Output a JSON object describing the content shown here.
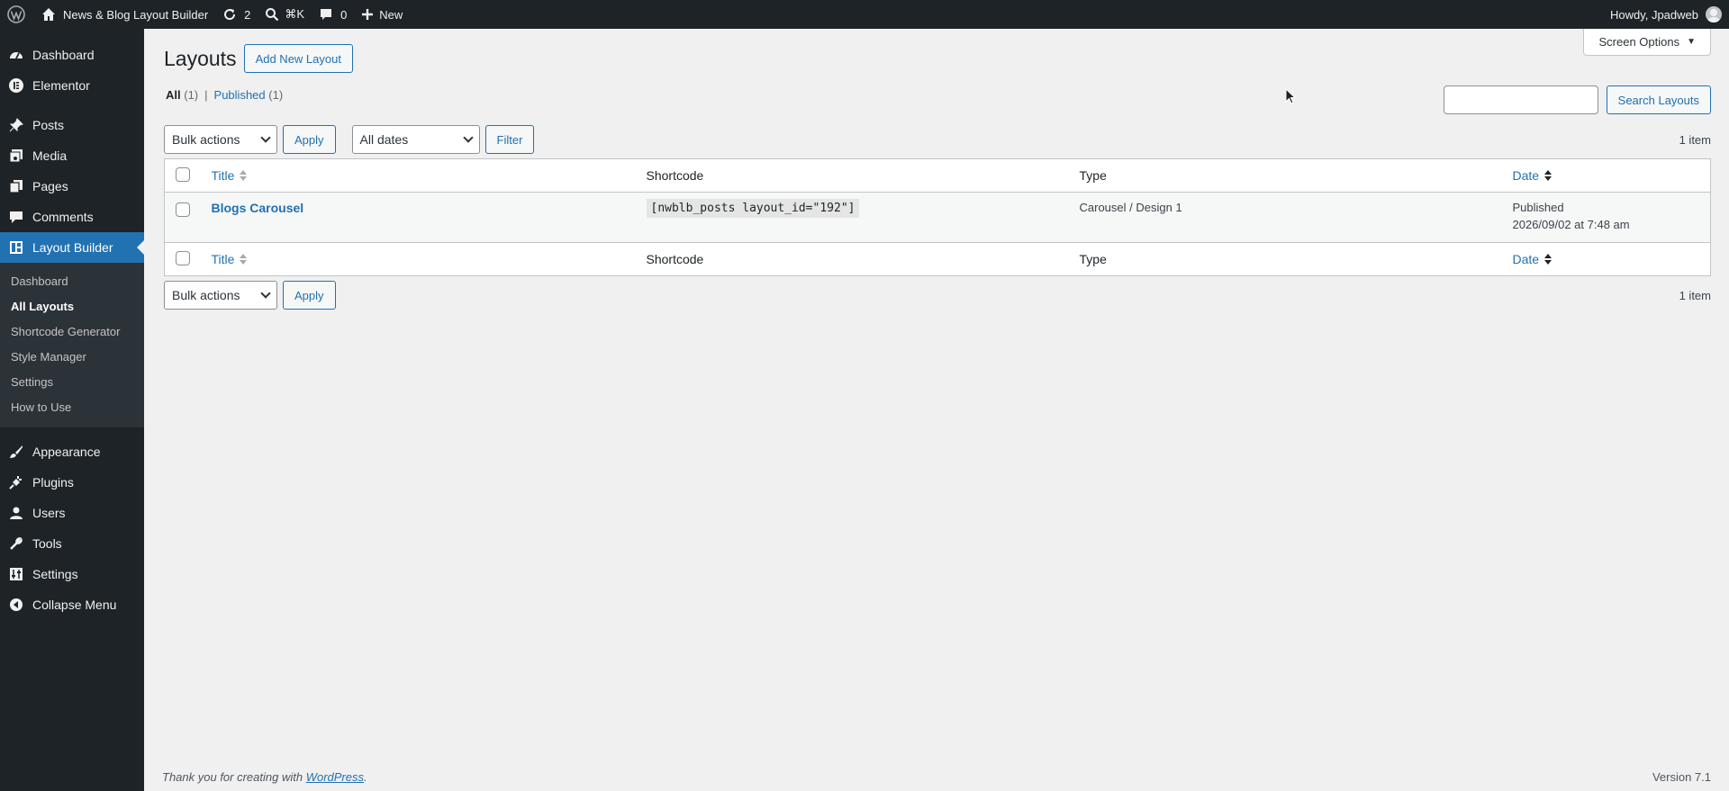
{
  "adminbar": {
    "site_name": "News & Blog Layout Builder",
    "updates_count": "2",
    "search_shortcut": "⌘K",
    "comments_count": "0",
    "new_label": "New",
    "howdy": "Howdy, Jpadweb"
  },
  "sidebar": {
    "items": [
      {
        "label": "Dashboard",
        "icon": "dashboard-icon"
      },
      {
        "label": "Elementor",
        "icon": "elementor-icon"
      },
      {
        "label": "Posts",
        "icon": "pushpin-icon"
      },
      {
        "label": "Media",
        "icon": "media-icon"
      },
      {
        "label": "Pages",
        "icon": "pages-icon"
      },
      {
        "label": "Comments",
        "icon": "comment-icon"
      },
      {
        "label": "Layout Builder",
        "icon": "layout-icon"
      },
      {
        "label": "Appearance",
        "icon": "brush-icon"
      },
      {
        "label": "Plugins",
        "icon": "plug-icon"
      },
      {
        "label": "Users",
        "icon": "user-icon"
      },
      {
        "label": "Tools",
        "icon": "wrench-icon"
      },
      {
        "label": "Settings",
        "icon": "sliders-icon"
      },
      {
        "label": "Collapse Menu",
        "icon": "collapse-icon"
      }
    ],
    "submenu": [
      "Dashboard",
      "All Layouts",
      "Shortcode Generator",
      "Style Manager",
      "Settings",
      "How to Use"
    ],
    "current_submenu": "All Layouts"
  },
  "screen_options": "Screen Options",
  "page": {
    "title": "Layouts",
    "add_new": "Add New Layout"
  },
  "views": {
    "all_label": "All",
    "all_count": "(1)",
    "published_label": "Published",
    "published_count": "(1)"
  },
  "search": {
    "value": "",
    "button": "Search Layouts"
  },
  "tablenav_top": {
    "bulk_actions": "Bulk actions",
    "apply": "Apply",
    "dates": "All dates",
    "filter": "Filter",
    "count": "1 item"
  },
  "table": {
    "columns": [
      "Title",
      "Shortcode",
      "Type",
      "Date"
    ],
    "rows": [
      {
        "title": "Blogs Carousel",
        "shortcode": "[nwblb_posts layout_id=\"192\"]",
        "type": "Carousel / Design 1",
        "status": "Published",
        "date": "2026/09/02 at 7:48 am"
      }
    ]
  },
  "tablenav_bottom": {
    "bulk_actions": "Bulk actions",
    "apply": "Apply",
    "count": "1 item"
  },
  "footer": {
    "thanks_prefix": "Thank you for creating with ",
    "wordpress": "WordPress",
    "thanks_suffix": ".",
    "version": "Version 7.1"
  }
}
